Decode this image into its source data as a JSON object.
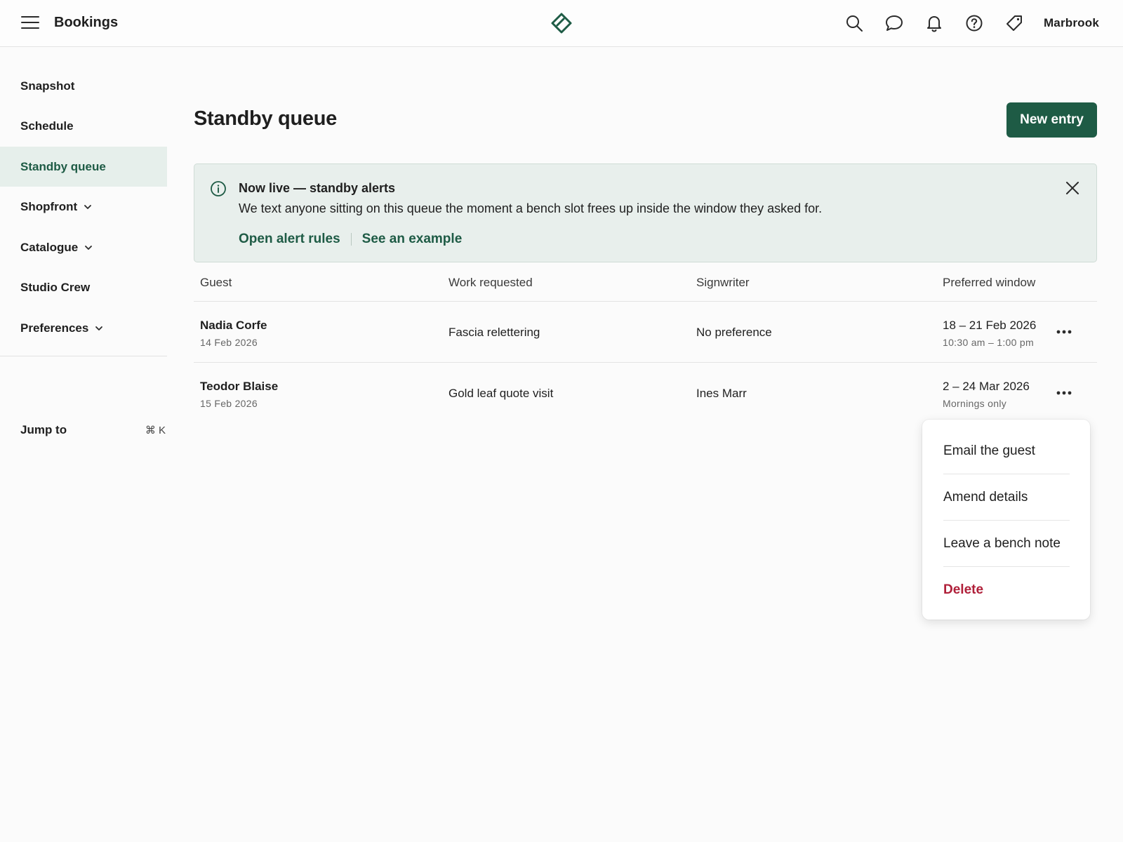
{
  "header": {
    "title": "Bookings",
    "account": "Marbrook",
    "icons": [
      "menu-icon",
      "logo-icon",
      "search-icon",
      "chat-icon",
      "bell-icon",
      "help-icon",
      "tag-icon"
    ]
  },
  "sidebar": {
    "items": [
      {
        "label": "Snapshot"
      },
      {
        "label": "Schedule"
      },
      {
        "label": "Standby queue"
      },
      {
        "label": "Shopfront"
      },
      {
        "label": "Catalogue"
      },
      {
        "label": "Studio Crew"
      },
      {
        "label": "Preferences"
      }
    ],
    "jump_label": "Jump to",
    "jump_shortcut": "⌘ K"
  },
  "page": {
    "title": "Standby queue",
    "new_entry_label": "New entry"
  },
  "banner": {
    "title": "Now live — standby alerts",
    "body": "We text anyone sitting on this queue the moment a bench slot frees up inside the window they asked for.",
    "link_rules": "Open alert rules",
    "link_example": "See an example"
  },
  "table": {
    "columns": [
      "Guest",
      "Work requested",
      "Signwriter",
      "Preferred window"
    ],
    "rows": [
      {
        "guest": "Nadia Corfe",
        "date": "14 Feb 2026",
        "work": "Fascia relettering",
        "signwriter": "No preference",
        "window": "18 – 21 Feb 2026",
        "window_detail": "10:30 am – 1:00 pm"
      },
      {
        "guest": "Teodor Blaise",
        "date": "15 Feb 2026",
        "work": "Gold leaf quote visit",
        "signwriter": "Ines Marr",
        "window": "2 – 24 Mar 2026",
        "window_detail": "Mornings only"
      }
    ]
  },
  "menu": {
    "items": [
      "Email the guest",
      "Amend details",
      "Leave a bench note",
      "Delete"
    ]
  },
  "colors": {
    "accent": "#1e5b45",
    "banner_bg": "#e8efec",
    "active_nav_bg": "#e6efeb",
    "danger": "#b0203a"
  }
}
